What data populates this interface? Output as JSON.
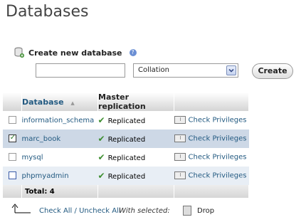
{
  "header": {
    "title": "Databases"
  },
  "create": {
    "label": "Create new database",
    "name_value": "",
    "collation_value": "Collation",
    "button_label": "Create"
  },
  "table": {
    "headers": {
      "database": "Database",
      "master_replication": "Master replication"
    },
    "rows": [
      {
        "name": "information_schema",
        "replication": "Replicated",
        "privileges": "Check Privileges",
        "checked": false
      },
      {
        "name": "marc_book",
        "replication": "Replicated",
        "privileges": "Check Privileges",
        "checked": true
      },
      {
        "name": "mysql",
        "replication": "Replicated",
        "privileges": "Check Privileges",
        "checked": false
      },
      {
        "name": "phpmyadmin",
        "replication": "Replicated",
        "privileges": "Check Privileges",
        "checked": false
      }
    ],
    "total": "Total: 4"
  },
  "footer": {
    "check_all": "Check All",
    "separator": "/",
    "uncheck_all": "Uncheck All",
    "with_selected": "With selected:",
    "drop": "Drop"
  },
  "colors": {
    "link": "#235a81",
    "accent_green": "#3c8d2f",
    "row_alt": "#e8eef5"
  }
}
